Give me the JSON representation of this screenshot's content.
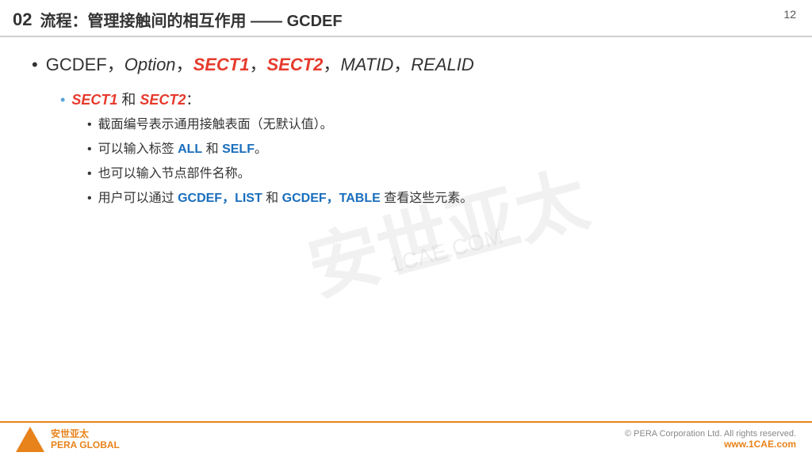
{
  "header": {
    "number": "02",
    "title": "流程：管理接触间的相互作用 —— GCDEF",
    "page": "12"
  },
  "main_bullet": {
    "prefix": "GCDEF，",
    "option": "Option",
    "comma1": "，",
    "sect1": "SECT1",
    "comma2": "，",
    "sect2": "SECT2",
    "comma3": "，",
    "matid": "MATID",
    "comma4": "，",
    "realid": "REALID"
  },
  "sub_bullet": {
    "sect1": "SECT1",
    "text_and": " 和 ",
    "sect2": "SECT2",
    "colon": "："
  },
  "subsub_bullets": [
    {
      "text": "截面编号表示通用接触表面（无默认值）。"
    },
    {
      "text_before": "可以输入标签 ",
      "all": "ALL",
      "text_mid": " 和 ",
      "self": "SELF",
      "text_after": "。"
    },
    {
      "text": "也可以输入节点部件名称。"
    },
    {
      "text_before": "用户可以通过 ",
      "gcdef1": "GCDEF，LIST",
      "text_mid": " 和 ",
      "gcdef2": "GCDEF，TABLE",
      "text_after": " 查看这些元素。"
    }
  ],
  "watermark": {
    "chinese": "安世亚太",
    "english": "1CAE.COM"
  },
  "footer": {
    "logo_line1": "安世亚太",
    "logo_line2": "PERA GLOBAL",
    "copyright": "©  PERA Corporation Ltd. All rights reserved.",
    "url": "www.1CAE.com"
  }
}
